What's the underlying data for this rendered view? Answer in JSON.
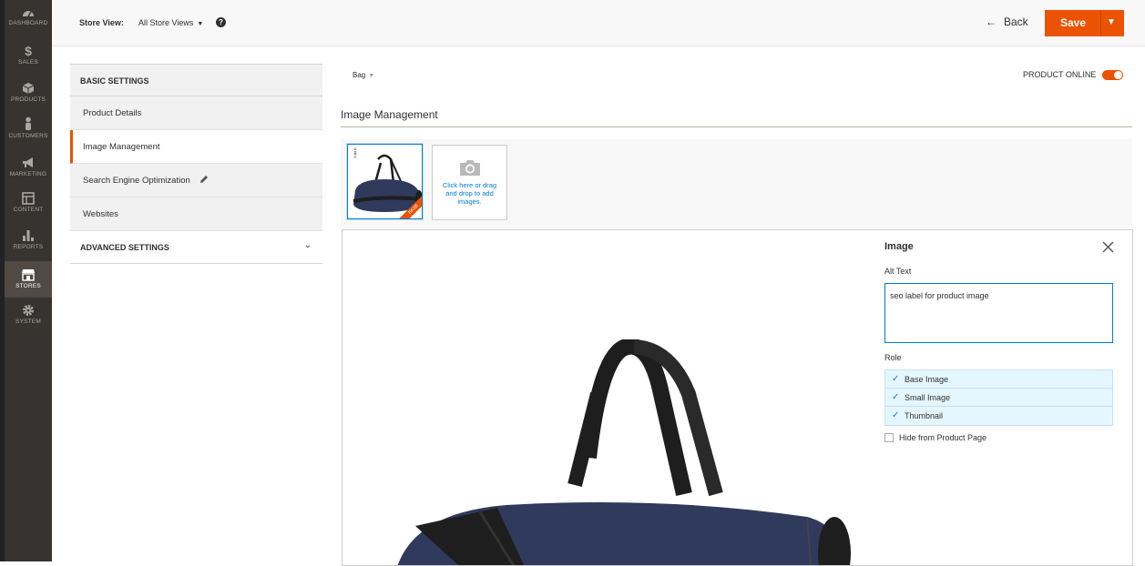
{
  "nav": [
    {
      "key": "dashboard",
      "label": "DASHBOARD",
      "icon": "dashboard-icon"
    },
    {
      "key": "sales",
      "label": "SALES",
      "icon": "dollar-icon"
    },
    {
      "key": "products",
      "label": "PRODUCTS",
      "icon": "cube-icon"
    },
    {
      "key": "customers",
      "label": "CUSTOMERS",
      "icon": "person-icon"
    },
    {
      "key": "marketing",
      "label": "MARKETING",
      "icon": "megaphone-icon"
    },
    {
      "key": "content",
      "label": "CONTENT",
      "icon": "layout-icon"
    },
    {
      "key": "reports",
      "label": "REPORTS",
      "icon": "bar-chart-icon"
    },
    {
      "key": "stores",
      "label": "STORES",
      "icon": "storefront-icon"
    },
    {
      "key": "system",
      "label": "SYSTEM",
      "icon": "gear-icon"
    }
  ],
  "nav_active": "stores",
  "header": {
    "store_view_label": "Store View:",
    "store_view_value": "All Store Views",
    "help": "?",
    "back_label": "Back",
    "save_label": "Save"
  },
  "side": {
    "basic_title": "BASIC SETTINGS",
    "tabs": [
      "Product Details",
      "Image Management",
      "Search Engine Optimization",
      "Websites"
    ],
    "active_tab": "Image Management",
    "advanced_title": "ADVANCED SETTINGS"
  },
  "main": {
    "attribute_set": "Bag",
    "product_online_label": "PRODUCT ONLINE",
    "product_online": true,
    "section_title": "Image Management",
    "base_badge": "BASE",
    "uploader_text": "Click here or drag and drop to add images."
  },
  "image_panel": {
    "title": "Image",
    "alt_label": "Alt Text",
    "alt_value": "seo label for product image",
    "role_label": "Role",
    "roles": [
      "Base Image",
      "Small Image",
      "Thumbnail"
    ],
    "hide_label": "Hide from Product Page"
  },
  "colors": {
    "accent": "#eb5202",
    "link": "#007bdb",
    "nav_bg": "#373330",
    "bag_body": "#2f3a5c",
    "strap": "#1e1e1e"
  }
}
